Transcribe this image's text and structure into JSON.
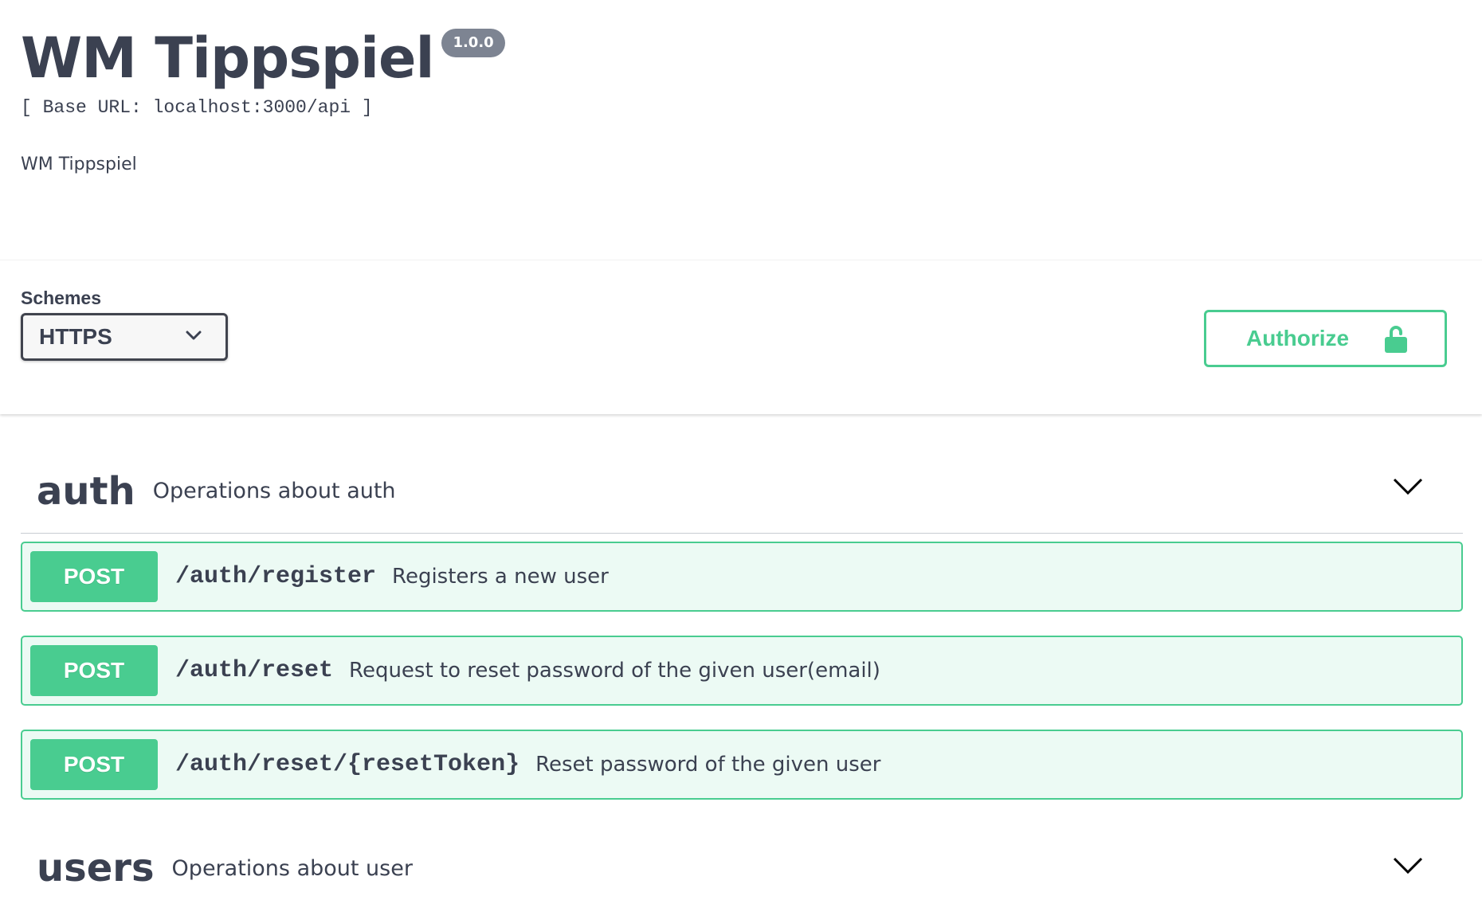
{
  "info": {
    "title": "WM Tippspiel",
    "version": "1.0.0",
    "base_url": "[ Base URL: localhost:3000/api ]",
    "description": "WM Tippspiel"
  },
  "schemes": {
    "label": "Schemes",
    "selected": "HTTPS"
  },
  "authorize": {
    "label": "Authorize"
  },
  "tags": [
    {
      "name": "auth",
      "description": "Operations about auth",
      "operations": [
        {
          "method": "POST",
          "path": "/auth/register",
          "summary": "Registers a new user"
        },
        {
          "method": "POST",
          "path": "/auth/reset",
          "summary": "Request to reset password of the given user(email)"
        },
        {
          "method": "POST",
          "path": "/auth/reset/{resetToken}",
          "summary": "Reset password of the given user"
        }
      ]
    },
    {
      "name": "users",
      "description": "Operations about user"
    }
  ],
  "colors": {
    "post": "#49cc90",
    "text": "#3b4151",
    "version_badge": "#7d8492"
  },
  "icons": {
    "select_chevron": "chevron-down-icon",
    "authorize_lock": "lock-open-icon",
    "tag_chevron": "chevron-down-icon"
  }
}
